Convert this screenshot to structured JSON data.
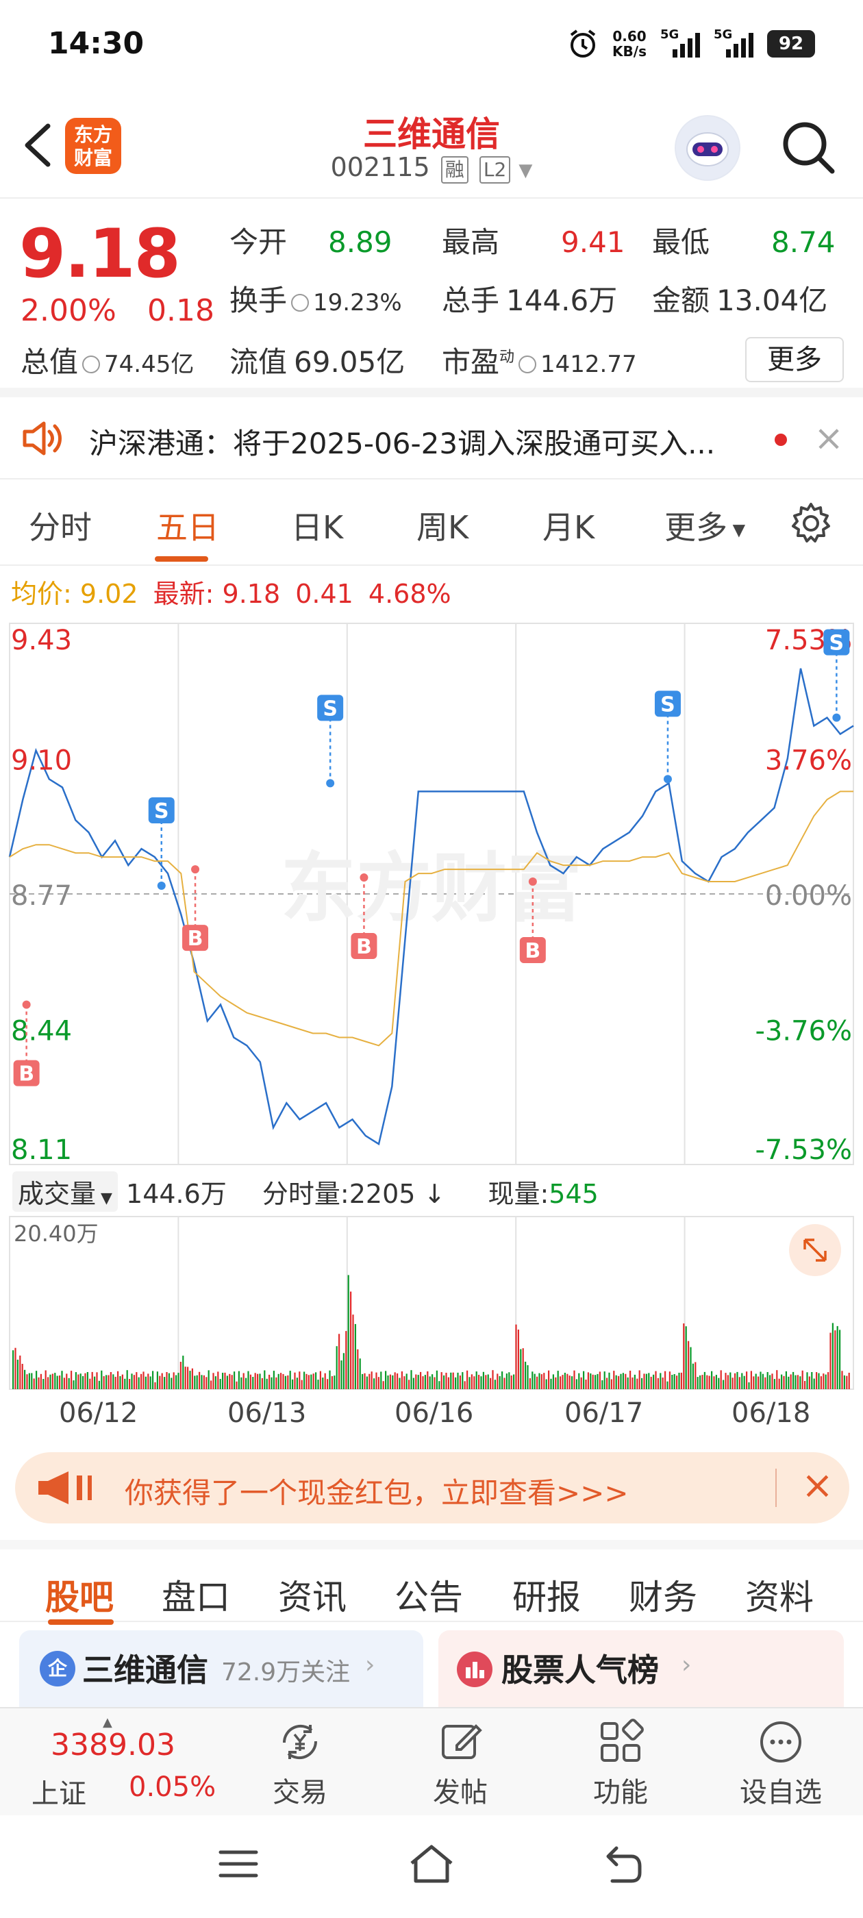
{
  "status": {
    "time": "14:30",
    "net_speed": "0.60",
    "net_unit": "KB/s",
    "sim1": "5G",
    "sim2": "5G",
    "battery": "92"
  },
  "header": {
    "logo_line1": "东方",
    "logo_line2": "财富",
    "stock_name": "三维通信",
    "stock_code": "002115",
    "tag_margin": "融",
    "tag_level": "L2"
  },
  "quote": {
    "price": "9.18",
    "change_pct": "2.00%",
    "change_amt": "0.18",
    "open_label": "今开",
    "open": "8.89",
    "high_label": "最高",
    "high": "9.41",
    "low_label": "最低",
    "low": "8.74",
    "turnover_label": "换手",
    "turnover": "19.23%",
    "volume_label": "总手",
    "volume": "144.6万",
    "amount_label": "金额",
    "amount": "13.04亿",
    "mktcap_label": "总值",
    "mktcap": "74.45亿",
    "float_label": "流值",
    "float": "69.05亿",
    "pe_label": "市盈",
    "pe_sup": "动",
    "pe": "1412.77",
    "more_label": "更多"
  },
  "notice": {
    "text": "沪深港通：将于2025-06-23调入深股通可买入..."
  },
  "chart_tabs": {
    "items": [
      "分时",
      "五日",
      "日K",
      "周K",
      "月K",
      "更多"
    ],
    "active": "五日"
  },
  "legend": {
    "avg_label": "均价:",
    "avg_value": "9.02",
    "latest_label": "最新:",
    "latest_value": "9.18",
    "latest_chg": "0.41",
    "latest_pct": "4.68%"
  },
  "chart_data": {
    "type": "line",
    "days": [
      "06/12",
      "06/13",
      "06/16",
      "06/17",
      "06/18"
    ],
    "y_left_ticks": [
      "9.43",
      "9.10",
      "8.77",
      "8.44",
      "8.11"
    ],
    "y_right_ticks": [
      "7.53%",
      "3.76%",
      "0.00%",
      "-3.76%",
      "-7.53%"
    ],
    "ylim": [
      8.11,
      9.43
    ],
    "prev_close": 8.77,
    "series": [
      {
        "color": "#2a6fc9",
        "values": [
          8.86,
          9.0,
          9.12,
          9.05,
          9.03,
          8.95,
          8.92,
          8.86,
          8.9,
          8.84,
          8.88,
          8.86,
          8.82,
          8.72,
          8.6,
          8.46,
          8.5,
          8.42,
          8.4,
          8.36,
          8.2,
          8.26,
          8.22,
          8.24,
          8.26,
          8.2,
          8.22,
          8.18,
          8.16,
          8.3,
          8.66,
          9.02,
          9.02,
          9.02,
          9.02,
          9.02,
          9.02,
          9.02,
          9.02,
          9.02,
          8.92,
          8.84,
          8.82,
          8.86,
          8.84,
          8.88,
          8.9,
          8.92,
          8.96,
          9.02,
          9.04,
          8.85,
          8.82,
          8.8,
          8.86,
          8.88,
          8.92,
          8.95,
          8.98,
          9.1,
          9.32,
          9.18,
          9.2,
          9.16,
          9.18
        ]
      },
      {
        "color": "#e6b040",
        "values": [
          8.86,
          8.88,
          8.89,
          8.89,
          8.88,
          8.87,
          8.87,
          8.86,
          8.86,
          8.86,
          8.86,
          8.85,
          8.85,
          8.82,
          8.58,
          8.55,
          8.52,
          8.5,
          8.48,
          8.47,
          8.46,
          8.45,
          8.44,
          8.43,
          8.43,
          8.42,
          8.42,
          8.41,
          8.4,
          8.43,
          8.8,
          8.82,
          8.82,
          8.83,
          8.83,
          8.83,
          8.83,
          8.83,
          8.83,
          8.83,
          8.87,
          8.85,
          8.84,
          8.84,
          8.84,
          8.85,
          8.85,
          8.85,
          8.86,
          8.86,
          8.87,
          8.82,
          8.81,
          8.8,
          8.8,
          8.8,
          8.81,
          8.82,
          8.83,
          8.84,
          8.9,
          8.96,
          9.0,
          9.02,
          9.02
        ]
      }
    ],
    "markers": [
      {
        "type": "S",
        "day": "06/12",
        "price": 8.79
      },
      {
        "type": "B",
        "day": "06/12",
        "price": 8.5
      },
      {
        "type": "S",
        "day": "06/13",
        "price": 9.04
      },
      {
        "type": "B",
        "day": "06/13",
        "price": 8.83
      },
      {
        "type": "B",
        "day": "06/16",
        "price": 8.81
      },
      {
        "type": "S",
        "day": "06/17",
        "price": 9.05
      },
      {
        "type": "B",
        "day": "06/17",
        "price": 8.8
      },
      {
        "type": "S",
        "day": "06/18",
        "price": 9.2
      }
    ],
    "volume": {
      "label": "成交量",
      "total": "144.6万",
      "tick_label": "分时量:2205",
      "tick_arrow": "↓",
      "now_label": "现量:",
      "now_value": "545",
      "max_label": "20.40万"
    }
  },
  "promo": {
    "text": "你获得了一个现金红包，立即查看>>>"
  },
  "sub_tabs": {
    "items": [
      "股吧",
      "盘口",
      "资讯",
      "公告",
      "研报",
      "财务",
      "资料"
    ],
    "active": "股吧"
  },
  "cards": {
    "card1_icon": "企",
    "card1_title": "三维通信",
    "card1_sub": "72.9万关注",
    "card2_title": "股票人气榜"
  },
  "bottom_nav": {
    "index_value": "3389.03",
    "index_name": "上证",
    "index_pct": "0.05%",
    "items": [
      "交易",
      "发帖",
      "功能",
      "设自选"
    ]
  },
  "colors": {
    "up": "#e02a2a",
    "down": "#0a9a2a",
    "accent": "#e2591a"
  }
}
